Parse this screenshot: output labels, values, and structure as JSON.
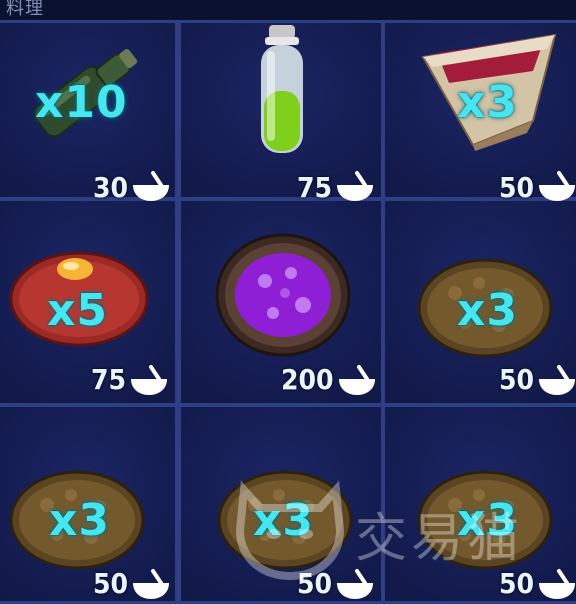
{
  "header": {
    "title": "料理"
  },
  "items": [
    {
      "name": "bottle",
      "qty": "x10",
      "cost": "30"
    },
    {
      "name": "green-potion",
      "qty": "",
      "cost": "75"
    },
    {
      "name": "pie-slice",
      "qty": "x3",
      "cost": "50"
    },
    {
      "name": "meat-egg",
      "qty": "x5",
      "cost": "75"
    },
    {
      "name": "purple-soup",
      "qty": "",
      "cost": "200"
    },
    {
      "name": "kibble",
      "qty": "x3",
      "cost": "50"
    },
    {
      "name": "kibble",
      "qty": "x3",
      "cost": "50"
    },
    {
      "name": "kibble",
      "qty": "x3",
      "cost": "50"
    },
    {
      "name": "kibble",
      "qty": "x3",
      "cost": "50"
    }
  ],
  "watermark": {
    "text": "交易猫"
  },
  "colors": {
    "qty": "#45e6f0",
    "cost": "#eaf4ff",
    "cell_border": "#2e3f86"
  }
}
